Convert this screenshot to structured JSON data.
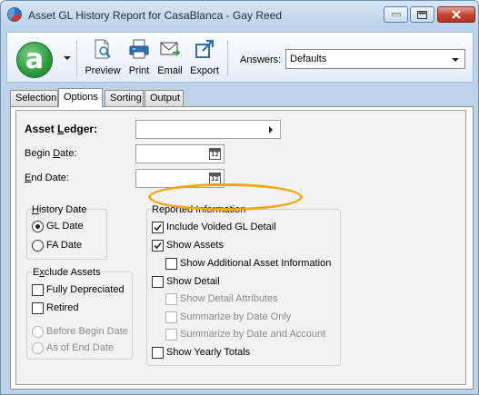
{
  "window": {
    "title": "Asset GL History Report for CasaBlanca - Gay Reed"
  },
  "colors": {
    "highlight": "#f3a51c",
    "close": "#c4412d",
    "logo": "#2a9b3d"
  },
  "toolbar": {
    "logo_letter": "a",
    "buttons": [
      {
        "label": "Preview",
        "icon": "preview-icon"
      },
      {
        "label": "Print",
        "icon": "printer-icon"
      },
      {
        "label": "Email",
        "icon": "email-icon"
      },
      {
        "label": "Export",
        "icon": "export-icon"
      }
    ],
    "answers_label": "Answers:",
    "answers_value": "Defaults"
  },
  "tabs": [
    {
      "label": "Selection",
      "active": false
    },
    {
      "label": "Options",
      "active": true
    },
    {
      "label": "Sorting",
      "active": false
    },
    {
      "label": "Output",
      "active": false
    }
  ],
  "form": {
    "asset_ledger": {
      "pre": "Asset ",
      "key": "L",
      "post": "edger:",
      "value": ""
    },
    "begin_date": {
      "pre": "Begin ",
      "key": "D",
      "post": "ate:",
      "value": ""
    },
    "end_date": {
      "pre": "",
      "key": "E",
      "post": "nd Date:",
      "value": ""
    },
    "calendar_glyph": "12"
  },
  "history_date": {
    "title_key": "H",
    "title_rest": "istory Date",
    "options": [
      {
        "label": "GL Date",
        "selected": true
      },
      {
        "label": "FA Date",
        "selected": false
      }
    ]
  },
  "exclude_assets": {
    "title_pre": "E",
    "title_key": "x",
    "title_rest": "clude Assets",
    "checkboxes": [
      {
        "label": "Fully Depreciated",
        "checked": false
      },
      {
        "label": "Retired",
        "checked": false
      }
    ],
    "radios": [
      {
        "label": "Before Begin Date",
        "disabled": true
      },
      {
        "label": "As of End Date",
        "disabled": true
      }
    ]
  },
  "reported_information": {
    "title": "Reported Information",
    "items": [
      {
        "label": "Include Voided GL Detail",
        "checked": true,
        "disabled": false
      },
      {
        "label": "Show Assets",
        "checked": true,
        "disabled": false
      },
      {
        "label": "Show Additional Asset Information",
        "checked": false,
        "disabled": false
      },
      {
        "label": "Show Detail",
        "checked": false,
        "disabled": false
      },
      {
        "label": "Show Detail Attributes",
        "checked": false,
        "disabled": true
      },
      {
        "label": "Summarize by Date Only",
        "checked": false,
        "disabled": true
      },
      {
        "label": "Summarize by Date and Account",
        "checked": false,
        "disabled": true
      },
      {
        "label": "Show Yearly Totals",
        "checked": false,
        "disabled": false
      }
    ]
  }
}
